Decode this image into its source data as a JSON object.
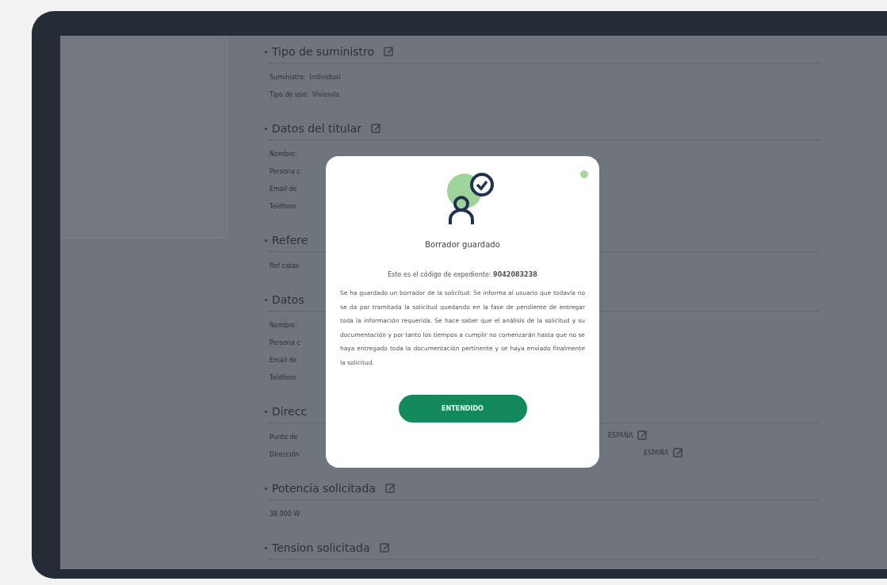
{
  "sections": [
    {
      "title": "Tipo de suministro",
      "editable": true,
      "rows": [
        {
          "label": "Suministro:",
          "value": "Individual"
        },
        {
          "label": "Tipo de uso:",
          "value": "Vivienda"
        }
      ]
    },
    {
      "title": "Datos del titular",
      "editable": true,
      "rows": [
        {
          "label": "Nombre:"
        },
        {
          "label": "Persona c"
        },
        {
          "label": "Email de"
        },
        {
          "label": "Teléfono"
        }
      ]
    },
    {
      "title": "Refere",
      "rows": [
        {
          "label": "Ref catas"
        }
      ]
    },
    {
      "title": "Datos",
      "rows": [
        {
          "label": "Nombre:"
        },
        {
          "label": "Persona c"
        },
        {
          "label": "Email de"
        },
        {
          "label": "Teléfono"
        }
      ]
    },
    {
      "title": "Direcc",
      "rows": [
        {
          "label": "Punto de",
          "far": "ESPAÑA",
          "far_edit": true
        },
        {
          "label": "Dirección",
          "far": "ESPAÑA",
          "far_edit": true
        }
      ]
    },
    {
      "title": "Potencia solicitada",
      "editable": true,
      "rows": [
        {
          "label": "38.000 W"
        }
      ]
    },
    {
      "title": "Tension solicitada",
      "editable": true
    }
  ],
  "modal": {
    "title": "Borrador guardado",
    "code_line": "Este es el código de expediente: **9042083238**",
    "message": "Se ha guardado un borrador de la solicitud. Se informa al usuario que todavía no se da por tramitada la solicitud quedando en la fase de pendiente de entregar toda la información requerida. Se hace saber que el análisis de la solicitud y su documentación y por tanto los tiempos a cumplir no comenzarán hasta que no se haya entregado toda la documentación pertinente y se haya enviado finalmente la solicitud.",
    "button": "ENTENDIDO"
  }
}
